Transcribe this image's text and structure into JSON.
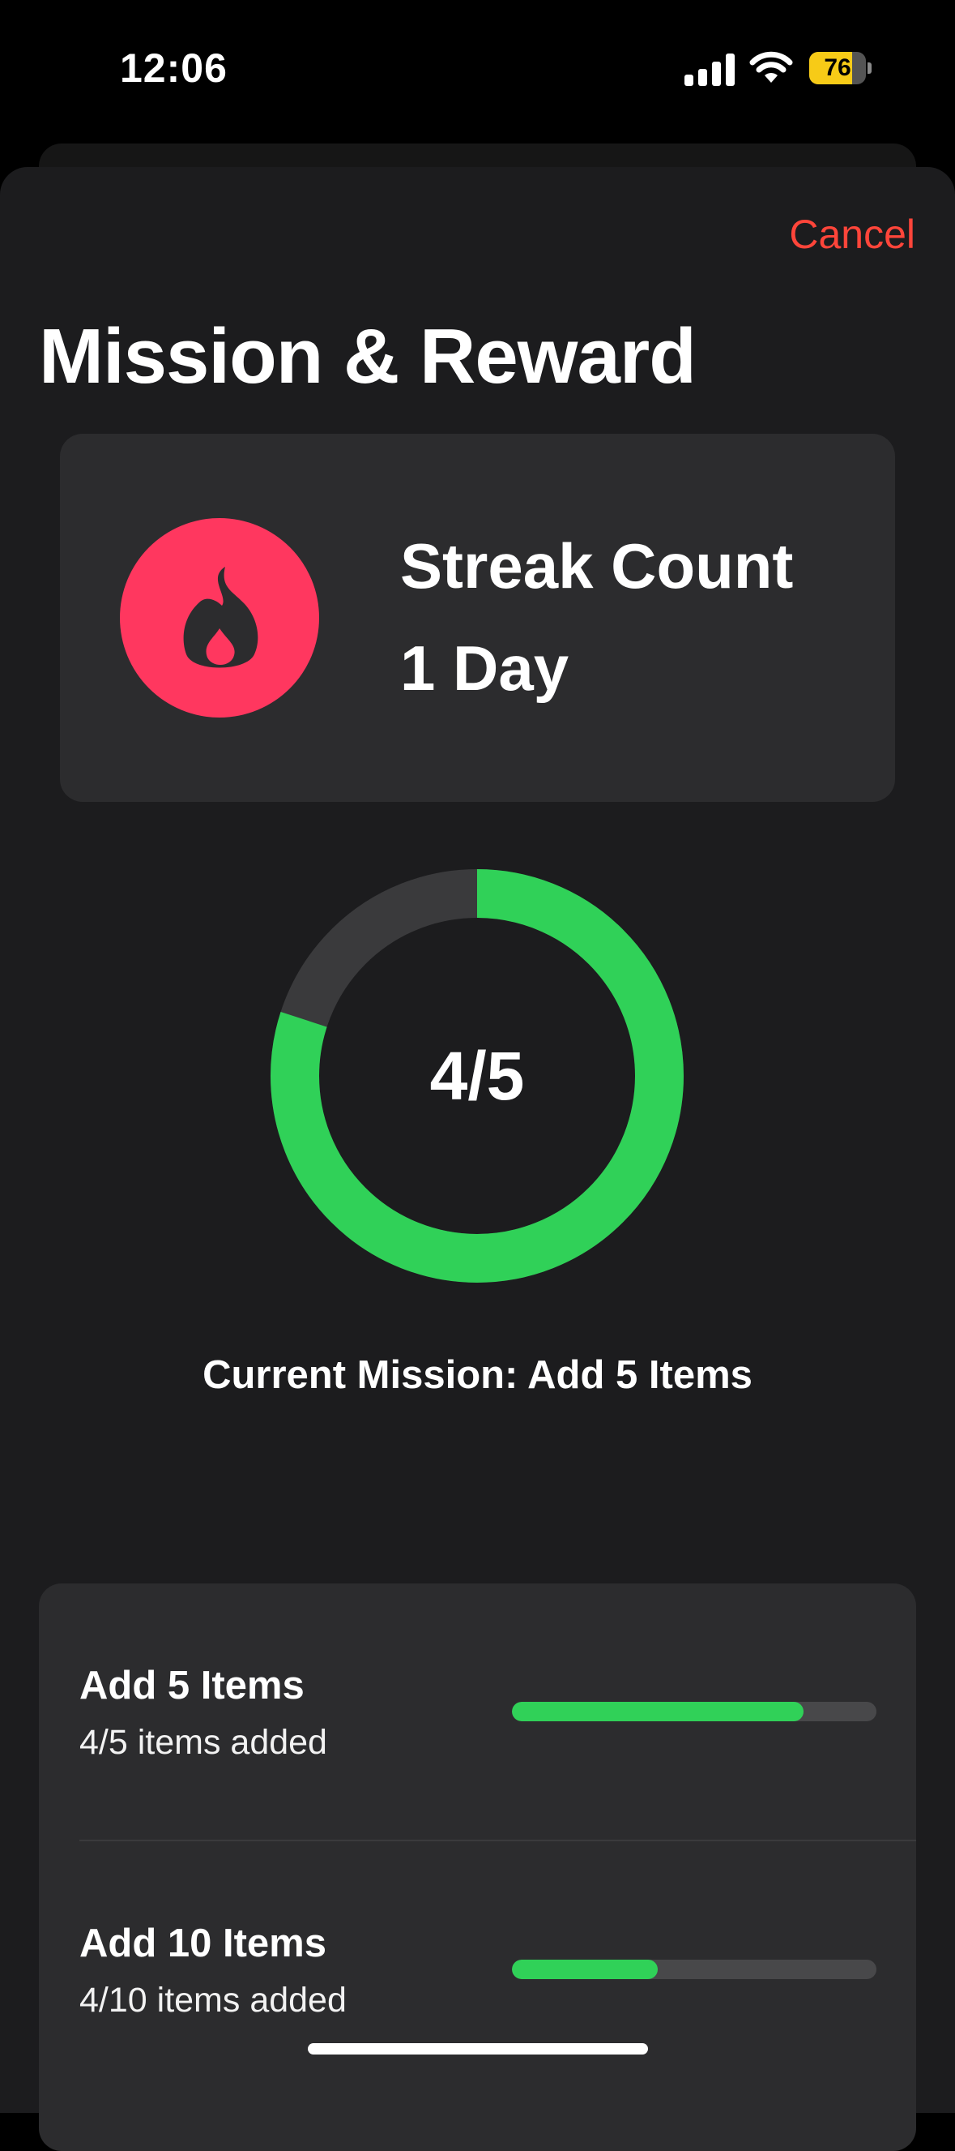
{
  "status_bar": {
    "time": "12:06",
    "battery_percent": "76",
    "battery_level": 0.76
  },
  "header": {
    "cancel_label": "Cancel",
    "title": "Mission & Reward"
  },
  "streak": {
    "label": "Streak Count",
    "value": "1 Day",
    "icon": "flame-icon",
    "color": "#ff375f"
  },
  "progress_ring": {
    "label": "4/5",
    "fraction": 0.8,
    "color": "#30d158",
    "track_color": "#3a3a3c"
  },
  "current_mission": {
    "text": "Current Mission:  Add 5 Items"
  },
  "missions": [
    {
      "title": "Add 5 Items",
      "subtitle": "4/5 items added",
      "progress": 0.8
    },
    {
      "title": "Add 10 Items",
      "subtitle": "4/10 items added",
      "progress": 0.4
    }
  ]
}
